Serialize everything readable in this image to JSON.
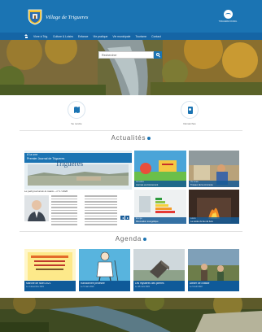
{
  "site": {
    "title": "Village de Trigueres",
    "partner_caption": "TRIGUERES RURAL"
  },
  "nav": {
    "items": [
      {
        "label": "Home"
      },
      {
        "label": "Vivre à Trig."
      },
      {
        "label": "Culture & Loisirs"
      },
      {
        "label": "Enfance"
      },
      {
        "label": "Vie pratique"
      },
      {
        "label": "Vie municipale"
      },
      {
        "label": "Tourisme"
      },
      {
        "label": "Contact"
      }
    ]
  },
  "search": {
    "value": "Rechercher"
  },
  "quick_links": {
    "map_label": "Se rendre",
    "docs_label": "Démarches"
  },
  "news": {
    "section_title": "Actualités",
    "featured": {
      "tag": "À la une",
      "title": "Premier Journal de Trigueres",
      "big_text": "Trigueres",
      "subtitle": "Le petit journal de la mairie – n°1 / 2020"
    },
    "cards": [
      {
        "category": "Actualités",
        "title": "Journée environnement"
      },
      {
        "category": "Vie locale",
        "title": "Travaux de la commune"
      },
      {
        "category": "Énergie",
        "title": "Rénovation énergétique"
      },
      {
        "category": "Loisirs",
        "title": "La soirée du feu de bois"
      }
    ]
  },
  "agenda": {
    "section_title": "Agenda",
    "items": [
      {
        "title": "Marché de Noël 2021",
        "date": "Le 4 décembre 2021"
      },
      {
        "title": "Randonnée pédestre",
        "date": "Le 5 mars 2022"
      },
      {
        "title": "Les mystères des pierres",
        "date": "Le 18 mars 2022"
      },
      {
        "title": "Atelier de chasse",
        "date": "Le 9 avril 2022"
      }
    ]
  },
  "colors": {
    "primary": "#1b74b3",
    "nav": "#1565a5",
    "caption": "#0f5a99"
  }
}
